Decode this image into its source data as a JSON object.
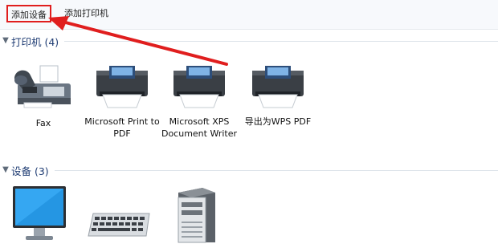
{
  "toolbar": {
    "add_device": "添加设备",
    "add_printer": "添加打印机"
  },
  "sections": {
    "printers": {
      "title": "打印机 (4)"
    },
    "devices": {
      "title": "设备 (3)"
    }
  },
  "printers": [
    {
      "label": "Fax",
      "icon": "fax-icon"
    },
    {
      "label": "Microsoft Print to PDF",
      "icon": "printer-icon"
    },
    {
      "label": "Microsoft XPS Document Writer",
      "icon": "printer-icon"
    },
    {
      "label": "导出为WPS PDF",
      "icon": "printer-icon"
    }
  ],
  "devices": [
    {
      "icon": "monitor-icon"
    },
    {
      "icon": "keyboard-icon"
    },
    {
      "icon": "computer-tower-icon"
    }
  ],
  "colors": {
    "highlight_red": "#e01e1e",
    "section_title": "#1f3c73"
  }
}
